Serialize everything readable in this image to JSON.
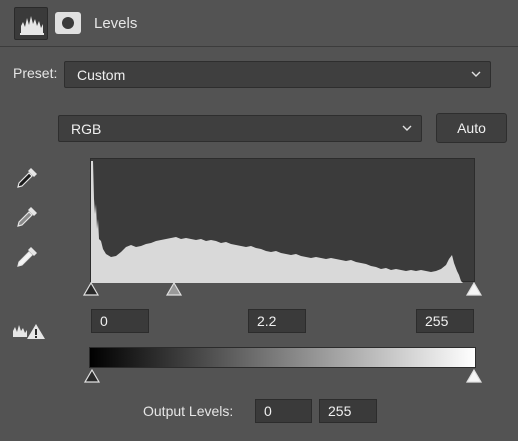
{
  "panel": {
    "title": "Levels",
    "icons": {
      "adjustment_tab": "histogram-icon",
      "mask_tab": "mask-icon"
    }
  },
  "preset": {
    "label": "Preset:",
    "value": "Custom"
  },
  "channel": {
    "value": "RGB"
  },
  "auto_button": {
    "label": "Auto"
  },
  "eyedroppers": [
    "black-point-eyedropper-icon",
    "gray-point-eyedropper-icon",
    "white-point-eyedropper-icon"
  ],
  "input_levels": {
    "black": "0",
    "gamma": "2.2",
    "white": "255"
  },
  "output_levels": {
    "label": "Output Levels:",
    "black": "0",
    "white": "255"
  },
  "colors": {
    "panel_bg": "#535353",
    "field_bg": "#3f3f3f",
    "histogram_fill": "#d9d9d9"
  }
}
